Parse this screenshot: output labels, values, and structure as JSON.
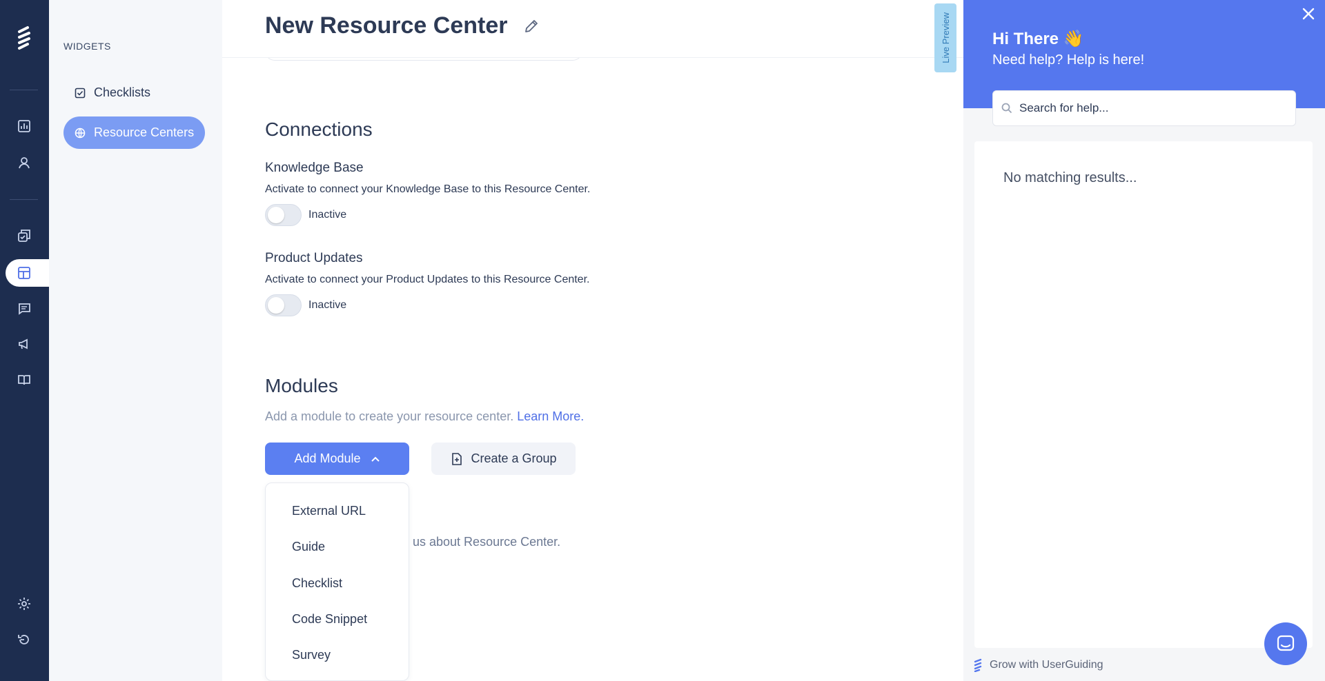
{
  "sidebar": {
    "section_title": "WIDGETS",
    "items": [
      {
        "label": "Checklists",
        "active": false
      },
      {
        "label": "Resource Centers",
        "active": true
      }
    ]
  },
  "header": {
    "title": "New Resource Center"
  },
  "connections": {
    "title": "Connections",
    "knowledge_base": {
      "label": "Knowledge Base",
      "description": "Activate to connect your Knowledge Base to this Resource Center.",
      "status": "Inactive"
    },
    "product_updates": {
      "label": "Product Updates",
      "description": "Activate to connect your Product Updates to this Resource Center.",
      "status": "Inactive"
    }
  },
  "modules": {
    "title": "Modules",
    "description": "Add a module to create your resource center.",
    "learn_more": "Learn More.",
    "add_module": "Add Module",
    "create_group": "Create a Group",
    "partial_text": "us about Resource Center.",
    "dropdown_options": [
      "External URL",
      "Guide",
      "Checklist",
      "Code Snippet",
      "Survey"
    ]
  },
  "live_preview": "Live Preview",
  "help_panel": {
    "greeting": "Hi There 👋",
    "subtitle": "Need help? Help is here!",
    "search_placeholder": "Search for help...",
    "empty_message": "No matching results...",
    "footer": "Grow with UserGuiding"
  },
  "colors": {
    "rail": "#1d2d4f",
    "accent": "#5b7ff1",
    "panel_header": "#5577ee",
    "active_sidebar": "#7b9cf3"
  }
}
